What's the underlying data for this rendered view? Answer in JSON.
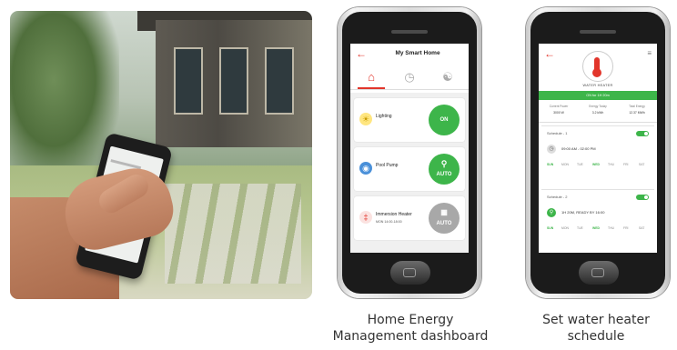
{
  "phone1": {
    "title": "My Smart Home",
    "tabs": [
      "home-icon",
      "gauge-icon",
      "network-icon"
    ],
    "devices": [
      {
        "name": "Lighting",
        "sub": "",
        "button": "ON",
        "icon": "bulb-icon"
      },
      {
        "name": "Pool Pump",
        "sub": "",
        "button": "AUTO",
        "icon": "pump-icon"
      },
      {
        "name": "Immersion Heater",
        "sub": "MON 14:00-18:00",
        "button": "AUTO",
        "icon": "thermometer-icon"
      }
    ]
  },
  "phone2": {
    "device_name": "WATER HEATER",
    "status": "ON for 1H 20m",
    "stats": [
      {
        "label": "Current Power",
        "value": "3000 W"
      },
      {
        "label": "Energy Today",
        "value": "3.2 kWh"
      },
      {
        "label": "Total Energy",
        "value": "12.37 MWh"
      }
    ],
    "schedules": [
      {
        "label": "Schedule - 1",
        "time": "09:00 AM - 02:00 PM",
        "days": [
          "SUN",
          "MON",
          "TUE",
          "WED",
          "THU",
          "FRI",
          "SAT"
        ],
        "active_days": [
          "SUN",
          "WED"
        ]
      },
      {
        "label": "Schedule - 2",
        "time": "1H 20M, READY BY 16:00",
        "days": [
          "SUN",
          "MON",
          "TUE",
          "WED",
          "THU",
          "FRI",
          "SAT"
        ],
        "active_days": [
          "SUN",
          "WED"
        ]
      }
    ]
  },
  "captions": {
    "left": [
      "Home Energy",
      "Management dashboard"
    ],
    "right": [
      "Set water heater",
      "schedule"
    ]
  },
  "colors": {
    "accent": "#e2352b",
    "green": "#3db54a",
    "gray": "#a8a8a8"
  }
}
